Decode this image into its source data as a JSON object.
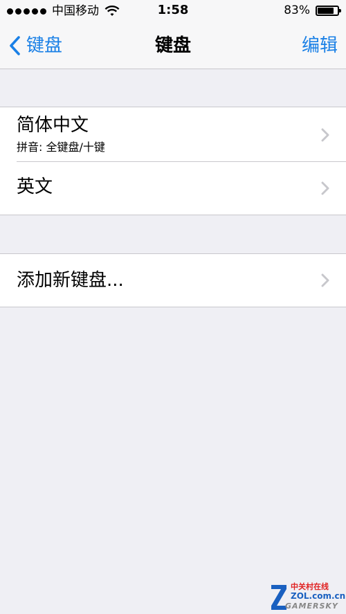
{
  "status_bar": {
    "carrier": "中国移动",
    "time": "1:58",
    "battery_percent_text": "83%",
    "battery_level": 0.83
  },
  "nav": {
    "back_label": "键盘",
    "title": "键盘",
    "edit_label": "编辑"
  },
  "keyboards": [
    {
      "title": "简体中文",
      "subtitle": "拼音: 全键盘/十键"
    },
    {
      "title": "英文"
    }
  ],
  "add_keyboard": {
    "title": "添加新键盘..."
  },
  "watermark": {
    "top": "中关村在线",
    "middle": "ZOL.com.cn",
    "bottom": "GAMERSKY"
  },
  "colors": {
    "accent": "#1a80e6",
    "background": "#efeff4",
    "separator": "#c8c7cc"
  }
}
